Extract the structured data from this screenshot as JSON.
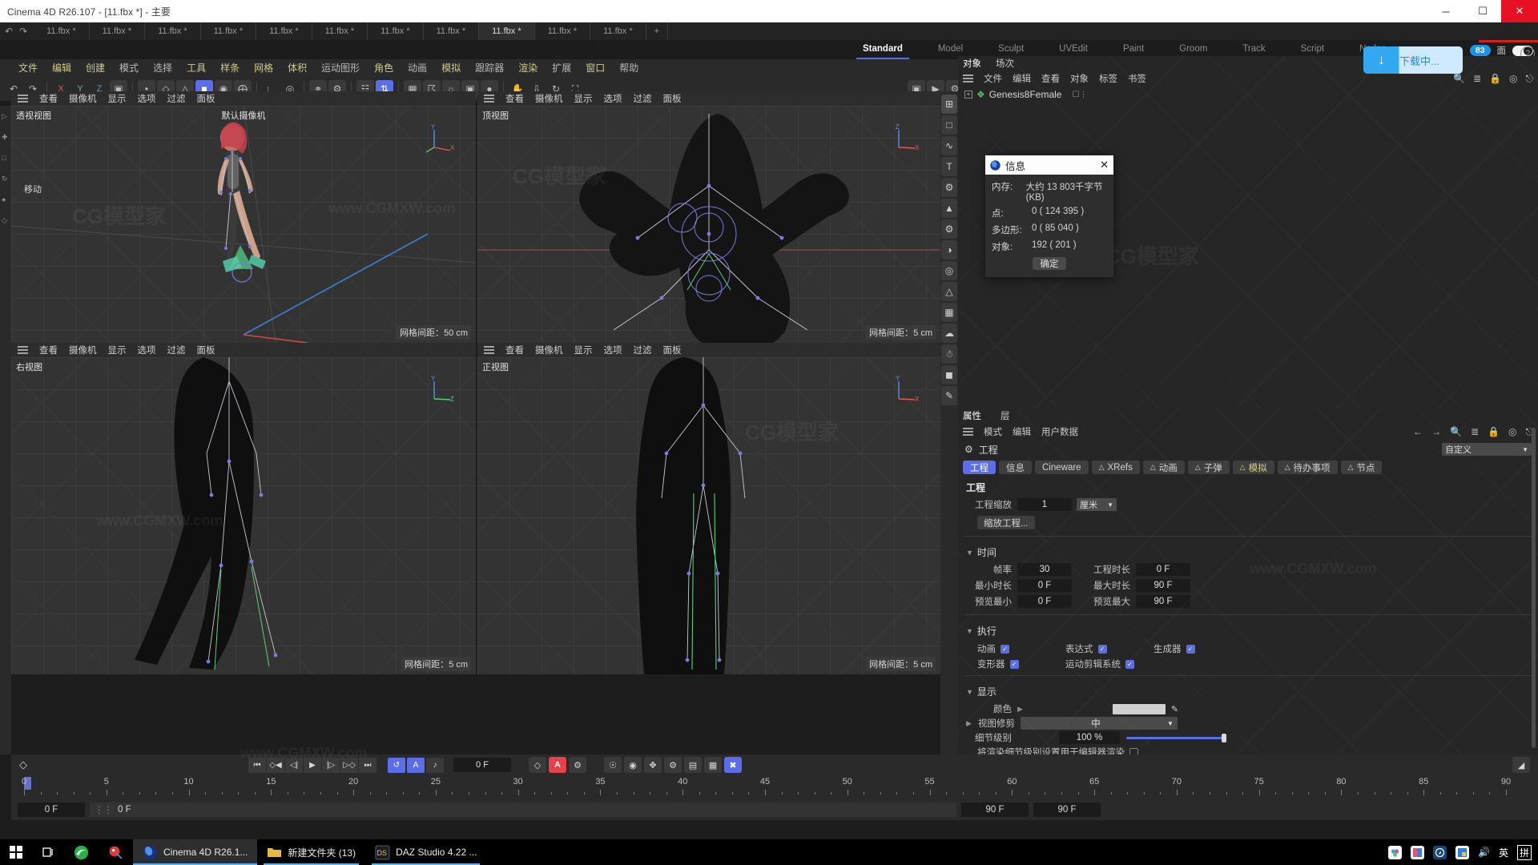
{
  "window": {
    "title": "Cinema 4D R26.107 - [11.fbx *] - 主要",
    "minimize": "─",
    "maximize": "☐",
    "close": "✕"
  },
  "doc_tabs": [
    {
      "label": "11.fbx *"
    },
    {
      "label": "11.fbx *"
    },
    {
      "label": "11.fbx *"
    },
    {
      "label": "11.fbx *"
    },
    {
      "label": "11.fbx *"
    },
    {
      "label": "11.fbx *"
    },
    {
      "label": "11.fbx *"
    },
    {
      "label": "11.fbx *"
    },
    {
      "label": "11.fbx *"
    },
    {
      "label": "11.fbx *"
    },
    {
      "label": "11.fbx *"
    }
  ],
  "undo_label": "↶",
  "redo_label": "↷",
  "new_tab_label": "+",
  "layout_tabs": [
    {
      "label": "Standard",
      "active": true
    },
    {
      "label": "Model",
      "active": false
    },
    {
      "label": "Sculpt",
      "active": false
    },
    {
      "label": "UVEdit",
      "active": false
    },
    {
      "label": "Paint",
      "active": false
    },
    {
      "label": "Groom",
      "active": false
    },
    {
      "label": "Track",
      "active": false
    },
    {
      "label": "Script",
      "active": false
    },
    {
      "label": "Nodes",
      "active": false
    }
  ],
  "notify_badge": "83",
  "notify_suffix": "面",
  "download": {
    "icon": "download-arrow",
    "label": "下载中..."
  },
  "help_label": "?",
  "menu": [
    {
      "label": "文件",
      "hl": true
    },
    {
      "label": "编辑",
      "hl": true
    },
    {
      "label": "创建",
      "hl": true
    },
    {
      "label": "模式",
      "hl": false
    },
    {
      "label": "选择",
      "hl": false
    },
    {
      "label": "工具",
      "hl": true
    },
    {
      "label": "样条",
      "hl": true
    },
    {
      "label": "网格",
      "hl": true
    },
    {
      "label": "体积",
      "hl": true
    },
    {
      "label": "运动图形",
      "hl": false
    },
    {
      "label": "角色",
      "hl": true
    },
    {
      "label": "动画",
      "hl": false
    },
    {
      "label": "模拟",
      "hl": true
    },
    {
      "label": "跟踪器",
      "hl": false
    },
    {
      "label": "渲染",
      "hl": true
    },
    {
      "label": "扩展",
      "hl": false
    },
    {
      "label": "窗口",
      "hl": true
    },
    {
      "label": "帮助",
      "hl": false
    }
  ],
  "toolbar_left": [
    {
      "icon": "undo-arrow",
      "name": "undo-button"
    },
    {
      "icon": "redo-arrow",
      "name": "redo-button"
    },
    {
      "icon": "x-axis",
      "name": "lock-x-axis-button",
      "label": "X"
    },
    {
      "icon": "y-axis",
      "name": "lock-y-axis-button",
      "label": "Y"
    },
    {
      "icon": "z-axis",
      "name": "lock-z-axis-button",
      "label": "Z"
    },
    {
      "icon": "world-coords",
      "name": "world-coordinate-button"
    }
  ],
  "viewport_menu": [
    "查看",
    "摄像机",
    "显示",
    "选项",
    "过滤",
    "面板"
  ],
  "viewports": [
    {
      "name": "透视视图",
      "center": "默认摄像机",
      "grid": "网格间距：50 cm",
      "move_label": "移动"
    },
    {
      "name": "顶视图",
      "center": "",
      "grid": "网格间距：5 cm",
      "move_label": ""
    },
    {
      "name": "右视图",
      "center": "",
      "grid": "网格间距：5 cm",
      "move_label": ""
    },
    {
      "name": "正视图",
      "center": "",
      "grid": "网格间距：5 cm",
      "move_label": ""
    }
  ],
  "object_manager": {
    "tabs": [
      {
        "label": "对象",
        "active": true
      },
      {
        "label": "场次",
        "active": false
      }
    ],
    "menus": [
      "文件",
      "编辑",
      "查看",
      "对象",
      "标签",
      "书签"
    ],
    "items": [
      {
        "label": "Genesis8Female"
      }
    ]
  },
  "info_dialog": {
    "title": "信息",
    "close": "✕",
    "rows": [
      {
        "key": "内存:",
        "value": "大约 13 803千字节(KB)"
      },
      {
        "key": "点:",
        "value": "0 ( 124 395 )"
      },
      {
        "key": "多边形:",
        "value": "0 ( 85 040 )"
      },
      {
        "key": "对象:",
        "value": "192 ( 201 )"
      }
    ],
    "ok": "确定"
  },
  "attributes": {
    "tabs": [
      {
        "label": "属性",
        "active": true
      },
      {
        "label": "层",
        "active": false
      }
    ],
    "menus": [
      "模式",
      "编辑",
      "用户数据"
    ],
    "object_name": "工程",
    "preset": "自定义",
    "tabrow": [
      {
        "label": "工程",
        "active": true,
        "bell": false,
        "yellow": false
      },
      {
        "label": "信息",
        "active": false,
        "bell": false,
        "yellow": false
      },
      {
        "label": "Cineware",
        "active": false,
        "bell": false,
        "yellow": false
      },
      {
        "label": "XRefs",
        "active": false,
        "bell": true,
        "yellow": false
      },
      {
        "label": "动画",
        "active": false,
        "bell": true,
        "yellow": false
      },
      {
        "label": "子弹",
        "active": false,
        "bell": true,
        "yellow": false
      },
      {
        "label": "模拟",
        "active": false,
        "bell": true,
        "yellow": true
      },
      {
        "label": "待办事项",
        "active": false,
        "bell": true,
        "yellow": false
      },
      {
        "label": "节点",
        "active": false,
        "bell": true,
        "yellow": false
      }
    ],
    "section_project": "工程",
    "project_scale_label": "工程缩放",
    "project_scale_value": "1",
    "project_scale_unit": "厘米",
    "scale_project_btn": "缩放工程...",
    "time": {
      "title": "时间",
      "fields": [
        {
          "label": "帧率",
          "value": "30"
        },
        {
          "label": "工程时长",
          "value": "0 F"
        },
        {
          "label": "最小时长",
          "value": "0 F"
        },
        {
          "label": "最大时长",
          "value": "90 F"
        },
        {
          "label": "预览最小",
          "value": "0 F"
        },
        {
          "label": "预览最大",
          "value": "90 F"
        }
      ]
    },
    "execute": {
      "title": "执行",
      "checks": [
        {
          "label": "动画",
          "checked": true
        },
        {
          "label": "表达式",
          "checked": true
        },
        {
          "label": "生成器",
          "checked": true
        },
        {
          "label": "变形器",
          "checked": true
        },
        {
          "label": "运动剪辑系统",
          "checked": true
        }
      ]
    },
    "display": {
      "title": "显示",
      "color_label": "颜色",
      "color_value": "#d0d0d0",
      "clip_label": "视图修剪",
      "clip_value": "中",
      "lod_label": "细节级别",
      "lod_value": "100 %",
      "render_lod_label": "将渲染细节级别设置用于编辑器渲染",
      "render_lod_checked": false
    }
  },
  "timeline": {
    "transport": [
      "⏮",
      "◇◀",
      "◁|",
      "▶",
      "|▷",
      "▷◇",
      "⏭"
    ],
    "loop_icon": "↺",
    "autokey_icon": "A",
    "sound_icon": "♪",
    "current_frame": "0 F",
    "record_icons": [
      "◇",
      "A",
      "⚙",
      "⦿",
      "◎",
      "✶",
      "⊕",
      "⬚",
      "⊞",
      "⌗"
    ],
    "ruler_ticks": [
      0,
      5,
      10,
      15,
      20,
      25,
      30,
      35,
      40,
      45,
      50,
      55,
      60,
      65,
      70,
      75,
      80,
      85,
      90
    ],
    "start_field": "0 F",
    "preview_field": "0 F",
    "end_left": "90 F",
    "end_right": "90 F"
  },
  "taskbar": {
    "start_icon": "windows-logo",
    "taskview_icon": "task-view",
    "items": [
      {
        "label": "",
        "icon": "edge-browser",
        "active": false
      },
      {
        "label": "",
        "icon": "paint-app",
        "active": false
      },
      {
        "label": "Cinema 4D R26.1...",
        "icon": "cinema4d",
        "active": true
      },
      {
        "label": "新建文件夹 (13)",
        "icon": "folder",
        "active": false
      },
      {
        "label": "DAZ Studio 4.22 ...",
        "icon": "daz-studio",
        "active": false
      }
    ],
    "tray": [
      {
        "icon": "app-colorful"
      },
      {
        "icon": "app-blue-panel"
      },
      {
        "icon": "app-compass"
      },
      {
        "icon": "app-onedrive"
      },
      {
        "icon": "volume"
      },
      {
        "icon": "ime-english",
        "label": "英"
      },
      {
        "icon": "ime-pinyin",
        "label": "拼"
      }
    ]
  },
  "watermarks": [
    "www.CGMXW.com",
    "CG模型家"
  ]
}
